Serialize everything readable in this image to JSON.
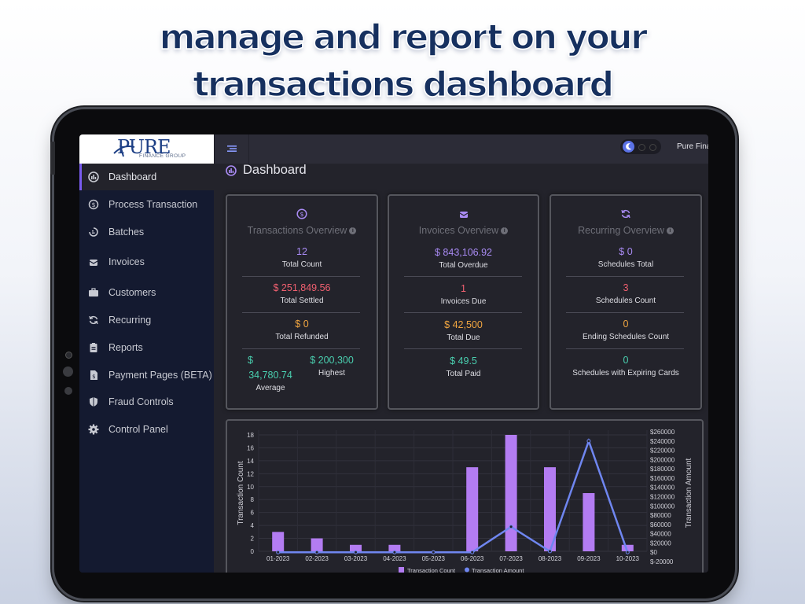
{
  "headline": {
    "line1": "manage and report on your",
    "line2": "transactions dashboard"
  },
  "logo": {
    "word": "PURE",
    "subtitle": "FINANCE GROUP"
  },
  "sidebar": {
    "items": [
      {
        "label": "Dashboard",
        "icon": "dashboard-icon",
        "active": true
      },
      {
        "label": "Process Transaction",
        "icon": "dollar-cycle-icon"
      },
      {
        "label": "Batches",
        "icon": "batches-icon"
      },
      {
        "label": "Invoices",
        "icon": "invoice-icon"
      },
      {
        "label": "Customers",
        "icon": "briefcase-icon"
      },
      {
        "label": "Recurring",
        "icon": "refresh-icon"
      },
      {
        "label": "Reports",
        "icon": "clipboard-icon"
      },
      {
        "label": "Payment Pages (BETA)",
        "icon": "payment-page-icon"
      },
      {
        "label": "Fraud Controls",
        "icon": "shield-icon"
      },
      {
        "label": "Control Panel",
        "icon": "gear-icon"
      }
    ]
  },
  "topbar": {
    "org_name": "Pure Finan"
  },
  "page": {
    "title": "Dashboard"
  },
  "cards": {
    "transactions": {
      "title": "Transactions Overview",
      "total_count": "12",
      "total_count_label": "Total Count",
      "total_settled": "$ 251,849.56",
      "total_settled_label": "Total Settled",
      "total_refunded": "$ 0",
      "total_refunded_label": "Total Refunded",
      "average_line1": "$",
      "average_line2": "34,780.74",
      "average_label": "Average",
      "highest": "$ 200,300",
      "highest_label": "Highest"
    },
    "invoices": {
      "title": "Invoices Overview",
      "total_overdue": "$ 843,106.92",
      "total_overdue_label": "Total Overdue",
      "invoices_due": "1",
      "invoices_due_label": "Invoices Due",
      "total_due": "$ 42,500",
      "total_due_label": "Total Due",
      "total_paid": "$ 49.5",
      "total_paid_label": "Total Paid"
    },
    "recurring": {
      "title": "Recurring Overview",
      "schedules_total": "$ 0",
      "schedules_total_label": "Schedules Total",
      "schedules_count": "3",
      "schedules_count_label": "Schedules Count",
      "ending_count": "0",
      "ending_count_label": "Ending Schedules Count",
      "expiring_cards": "0",
      "expiring_cards_label": "Schedules with Expiring Cards"
    }
  },
  "colors": {
    "accent": "#7a5cf0",
    "bar": "#b37cf2",
    "line": "#6f86f0",
    "red": "#f06070",
    "orange": "#f0a540",
    "teal": "#4ad0b0",
    "purple_value": "#a98bf4"
  },
  "chart_data": {
    "type": "bar",
    "categories": [
      "01-2023",
      "02-2023",
      "03-2023",
      "04-2023",
      "05-2023",
      "06-2023",
      "07-2023",
      "08-2023",
      "09-2023",
      "10-2023"
    ],
    "series": [
      {
        "name": "Transaction Count",
        "type": "bar",
        "axis": "left",
        "values": [
          3,
          2,
          1,
          1,
          0,
          13,
          18,
          13,
          9,
          1
        ]
      },
      {
        "name": "Transaction Amount",
        "type": "line",
        "axis": "right",
        "values": [
          0,
          0,
          0,
          0,
          0,
          0,
          55000,
          2000,
          240000,
          0
        ]
      }
    ],
    "ylabel": "Transaction Count",
    "ylabel_right": "Transaction Amount",
    "yticks": [
      "0",
      "2",
      "4",
      "6",
      "8",
      "10",
      "12",
      "14",
      "16",
      "18"
    ],
    "yticks_right": [
      "$-20000",
      "$0",
      "$20000",
      "$40000",
      "$60000",
      "$80000",
      "$100000",
      "$120000",
      "$140000",
      "$160000",
      "$180000",
      "$200000",
      "$220000",
      "$240000",
      "$260000"
    ],
    "ylim": [
      0,
      18
    ],
    "ylim_right": [
      -20000,
      260000
    ],
    "grid": true,
    "legend_position": "bottom"
  }
}
